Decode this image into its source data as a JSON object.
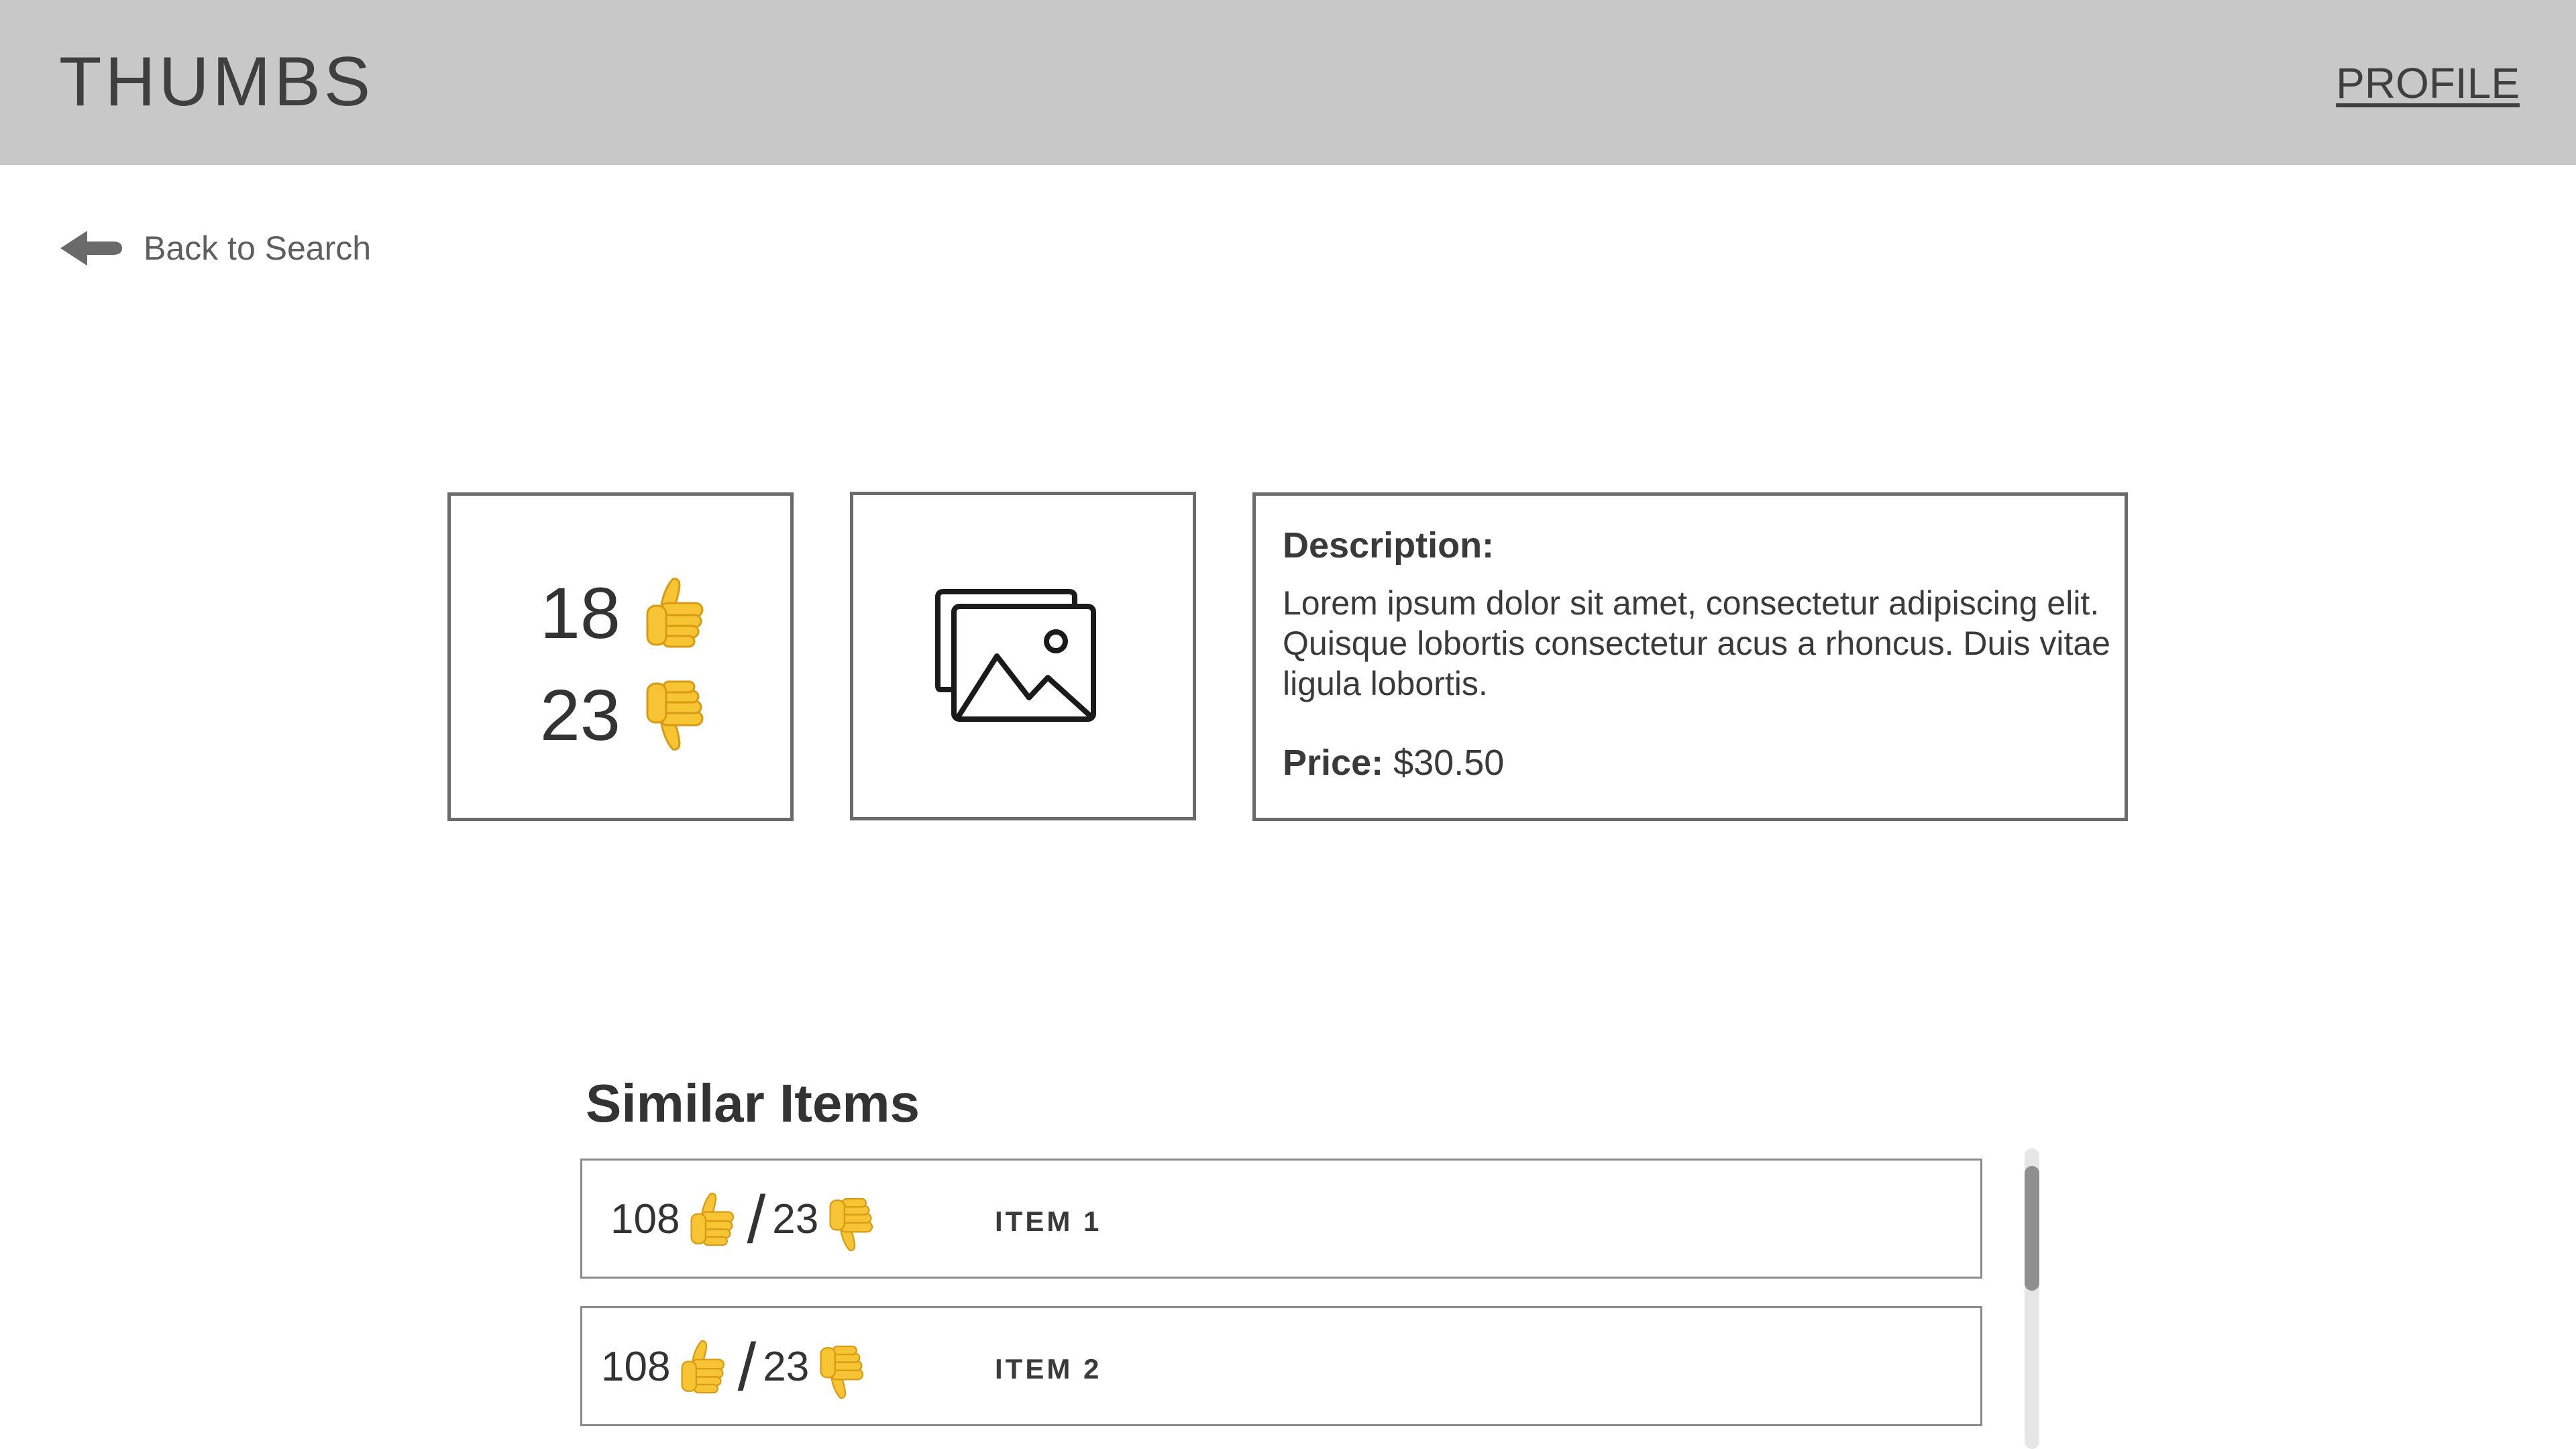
{
  "header": {
    "brand": "THUMBS",
    "profile_label": "PROFILE"
  },
  "nav": {
    "back_label": "Back to Search",
    "back_icon": "arrow-left-icon"
  },
  "product": {
    "thumbs_up": "18",
    "thumbs_down": "23",
    "image_icon": "image-gallery-icon",
    "description_title": "Description:",
    "description_text": "Lorem ipsum dolor sit amet, consectetur adipiscing elit. Quisque lobortis consectetur acus a rhoncus. Duis vitae ligula lobortis.",
    "price_label": "Price:",
    "price_value": "$30.50"
  },
  "similar": {
    "title": "Similar Items",
    "items": [
      {
        "thumbs_up": "108",
        "separator": "/",
        "thumbs_down": "23",
        "name": "ITEM 1"
      },
      {
        "thumbs_up": "108",
        "separator": "/",
        "thumbs_down": "23",
        "name": "ITEM 2"
      }
    ]
  },
  "colors": {
    "header_bg": "#c8c8c8",
    "thumb_yellow": "#f7c533",
    "thumb_outline": "#d99a14",
    "box_border": "#6b6b6b"
  }
}
